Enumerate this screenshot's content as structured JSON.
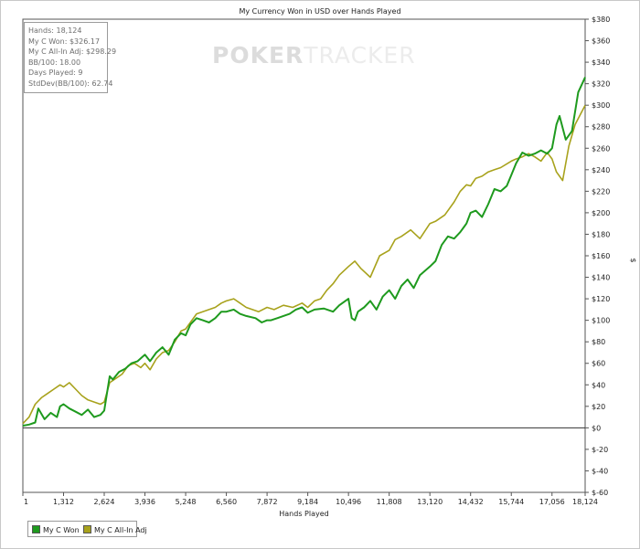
{
  "chart_data": {
    "type": "line",
    "title": "My Currency Won in USD over Hands Played",
    "xlabel": "Hands Played",
    "ylabel": "$",
    "xlim": [
      1,
      18124
    ],
    "ylim": [
      -60,
      380
    ],
    "x_ticks": [
      1,
      1312,
      2624,
      3936,
      5248,
      6560,
      7872,
      9184,
      10496,
      11808,
      13120,
      14432,
      15744,
      17056,
      18124
    ],
    "x_tick_labels": [
      "1",
      "1,312",
      "2,624",
      "3,936",
      "5,248",
      "6,560",
      "7,872",
      "9,184",
      "10,496",
      "11,808",
      "13,120",
      "14,432",
      "15,744",
      "17,056",
      "18,124"
    ],
    "y_ticks": [
      -60,
      -40,
      -20,
      0,
      20,
      40,
      60,
      80,
      100,
      120,
      140,
      160,
      180,
      200,
      220,
      240,
      260,
      280,
      300,
      320,
      340,
      360,
      380
    ],
    "y_tick_labels": [
      "$-60",
      "$-40",
      "$-20",
      "$0",
      "$20",
      "$40",
      "$60",
      "$80",
      "$100",
      "$120",
      "$140",
      "$160",
      "$180",
      "$200",
      "$220",
      "$240",
      "$260",
      "$280",
      "$300",
      "$320",
      "$340",
      "$360",
      "$380"
    ],
    "grid": false,
    "legend_position": "bottom-left",
    "series": [
      {
        "name": "My C Won",
        "color": "#1e9a1e",
        "x": [
          1,
          200,
          400,
          500,
          700,
          900,
          1100,
          1200,
          1312,
          1500,
          1700,
          1900,
          2100,
          2300,
          2500,
          2624,
          2700,
          2800,
          2900,
          3100,
          3300,
          3500,
          3700,
          3936,
          4100,
          4300,
          4500,
          4700,
          4900,
          5100,
          5248,
          5400,
          5600,
          5800,
          6000,
          6200,
          6400,
          6560,
          6800,
          7000,
          7200,
          7500,
          7700,
          7872,
          8000,
          8200,
          8400,
          8600,
          8800,
          9000,
          9184,
          9400,
          9700,
          10000,
          10200,
          10496,
          10600,
          10700,
          10800,
          11000,
          11200,
          11400,
          11600,
          11808,
          12000,
          12200,
          12400,
          12600,
          12800,
          13120,
          13300,
          13500,
          13700,
          13900,
          14100,
          14300,
          14432,
          14600,
          14800,
          15000,
          15200,
          15400,
          15600,
          15744,
          15900,
          16100,
          16300,
          16500,
          16700,
          16900,
          17056,
          17200,
          17300,
          17500,
          17700,
          17900,
          18124
        ],
        "values": [
          2,
          3,
          5,
          18,
          8,
          14,
          10,
          20,
          22,
          18,
          15,
          12,
          17,
          10,
          12,
          16,
          30,
          48,
          45,
          52,
          55,
          60,
          62,
          68,
          62,
          70,
          75,
          68,
          82,
          88,
          86,
          96,
          102,
          100,
          98,
          102,
          108,
          108,
          110,
          106,
          104,
          102,
          98,
          100,
          100,
          102,
          104,
          106,
          110,
          112,
          107,
          110,
          111,
          108,
          114,
          120,
          102,
          100,
          108,
          112,
          118,
          110,
          122,
          128,
          120,
          132,
          138,
          130,
          142,
          150,
          155,
          170,
          178,
          176,
          182,
          190,
          200,
          202,
          196,
          208,
          222,
          220,
          225,
          235,
          246,
          256,
          253,
          255,
          258,
          255,
          260,
          282,
          290,
          268,
          276,
          312,
          326
        ]
      },
      {
        "name": "My C All-In Adj",
        "color": "#a8a21c",
        "x": [
          1,
          200,
          400,
          600,
          800,
          1000,
          1200,
          1312,
          1500,
          1700,
          1900,
          2100,
          2300,
          2500,
          2624,
          2800,
          3000,
          3200,
          3400,
          3600,
          3800,
          3936,
          4100,
          4300,
          4500,
          4700,
          4900,
          5100,
          5248,
          5400,
          5600,
          5800,
          6000,
          6200,
          6400,
          6560,
          6800,
          7000,
          7200,
          7400,
          7600,
          7872,
          8100,
          8400,
          8700,
          9000,
          9184,
          9400,
          9600,
          9800,
          10000,
          10200,
          10496,
          10700,
          10900,
          11200,
          11500,
          11808,
          12000,
          12200,
          12500,
          12800,
          13120,
          13300,
          13600,
          13900,
          14100,
          14300,
          14432,
          14600,
          14800,
          15000,
          15200,
          15400,
          15744,
          15900,
          16100,
          16300,
          16500,
          16700,
          16900,
          17056,
          17200,
          17400,
          17600,
          17800,
          18124
        ],
        "values": [
          4,
          10,
          22,
          28,
          32,
          36,
          40,
          38,
          42,
          36,
          30,
          26,
          24,
          22,
          24,
          42,
          46,
          50,
          58,
          60,
          56,
          60,
          54,
          64,
          70,
          72,
          80,
          90,
          92,
          98,
          106,
          108,
          110,
          112,
          116,
          118,
          120,
          116,
          112,
          110,
          108,
          112,
          110,
          114,
          112,
          116,
          112,
          118,
          120,
          128,
          134,
          142,
          150,
          155,
          148,
          140,
          160,
          165,
          175,
          178,
          184,
          176,
          190,
          192,
          198,
          210,
          220,
          226,
          225,
          232,
          234,
          238,
          240,
          242,
          248,
          250,
          252,
          255,
          252,
          248,
          256,
          250,
          238,
          230,
          262,
          282,
          300
        ]
      }
    ]
  },
  "stats": {
    "hands": "Hands: 18,124",
    "won": "My C Won: $326.17",
    "allin": "My C All-In Adj: $298.29",
    "bb100": "BB/100: 18.00",
    "days": "Days Played: 9",
    "stddev": "StdDev(BB/100): 62.74"
  },
  "watermark": {
    "part1": "POKER",
    "part2": "TRACKER"
  },
  "legend": {
    "item1": "My C Won",
    "item2": "My C All-In Adj"
  }
}
